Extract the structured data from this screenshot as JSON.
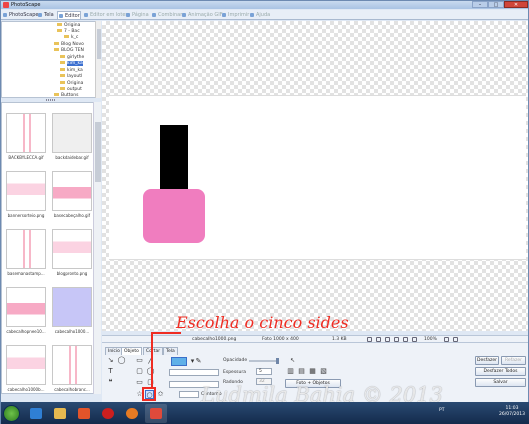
{
  "window": {
    "title": "PhotoScape",
    "controls": {
      "min": "–",
      "max": "□",
      "close": "✕"
    }
  },
  "tabs": [
    {
      "label": "PhotoScape",
      "state": "normal"
    },
    {
      "label": "Tela",
      "state": "normal"
    },
    {
      "label": "Editor",
      "state": "active"
    },
    {
      "label": "Editor em lotes",
      "state": "disabled"
    },
    {
      "label": "Página",
      "state": "disabled"
    },
    {
      "label": "Combinar",
      "state": "disabled"
    },
    {
      "label": "Animação GIF",
      "state": "disabled"
    },
    {
      "label": "Imprimir",
      "state": "disabled"
    },
    {
      "label": "Ajuda",
      "state": "disabled"
    }
  ],
  "tree": [
    "Origina",
    "7 - Bac",
    "k_c",
    "Blog Novo",
    "BLOG TEN",
    "girlythe",
    "kim_ka",
    "kim_ka",
    "layoutl",
    "Origina",
    "output",
    "Buttons"
  ],
  "thumbnails": [
    {
      "name": "BACKBYLECCA.gif",
      "kind": "pink-lines"
    },
    {
      "name": "backdaidebar.gif",
      "kind": "gray"
    },
    {
      "name": "bannersorteio.png",
      "kind": "banner"
    },
    {
      "name": "basecabeçalho.gif",
      "kind": "pink-bar"
    },
    {
      "name": "basemanastamp...",
      "kind": "pink-lines"
    },
    {
      "name": "blogpronto.png",
      "kind": "banner"
    },
    {
      "name": "cabecalhopnee10...",
      "kind": "pink-bar"
    },
    {
      "name": "cabecalho1000...",
      "kind": "lavender"
    },
    {
      "name": "cabecalho1000b...",
      "kind": "banner"
    },
    {
      "name": "cabecalhobranc...",
      "kind": "pink-lines"
    },
    {
      "name": "",
      "kind": "banner"
    },
    {
      "name": "",
      "kind": "banner"
    }
  ],
  "status": {
    "filename": "cabecalho1000.png",
    "photo_size": "Foto 1000 x 400",
    "file_size": "1.3 KB",
    "zoom": "100%"
  },
  "panel": {
    "tabs": [
      "Início",
      "Objeto",
      "Cortar",
      "Tela"
    ],
    "tools_row1": [
      "↘",
      "◯",
      "▭",
      "╱"
    ],
    "tools_row2": [
      "T",
      "▢",
      "◯"
    ],
    "tools_row3": [
      "❝",
      "▭",
      "▢"
    ],
    "tools_row4": [
      "☆",
      "○",
      "✩"
    ],
    "opacity_label": "Opacidade",
    "thickness_label": "Espessura",
    "thickness_value": "5",
    "radius_label": "Radondo",
    "radius_value": "32",
    "outline_label": "Contorno",
    "photo_objects_btn": "Foto + Objetos",
    "undo": "Desfazer",
    "redo": "Refazer",
    "undo_all": "Desfazer Todos",
    "save": "Salvar"
  },
  "annotation": {
    "text": "Escolha o cinco sides",
    "color": "#ef2c22"
  },
  "watermark": "Ludmila Bahia © 2013",
  "taskbar": {
    "lang": "PT",
    "time": "11:03",
    "date": "26/07/2013"
  }
}
